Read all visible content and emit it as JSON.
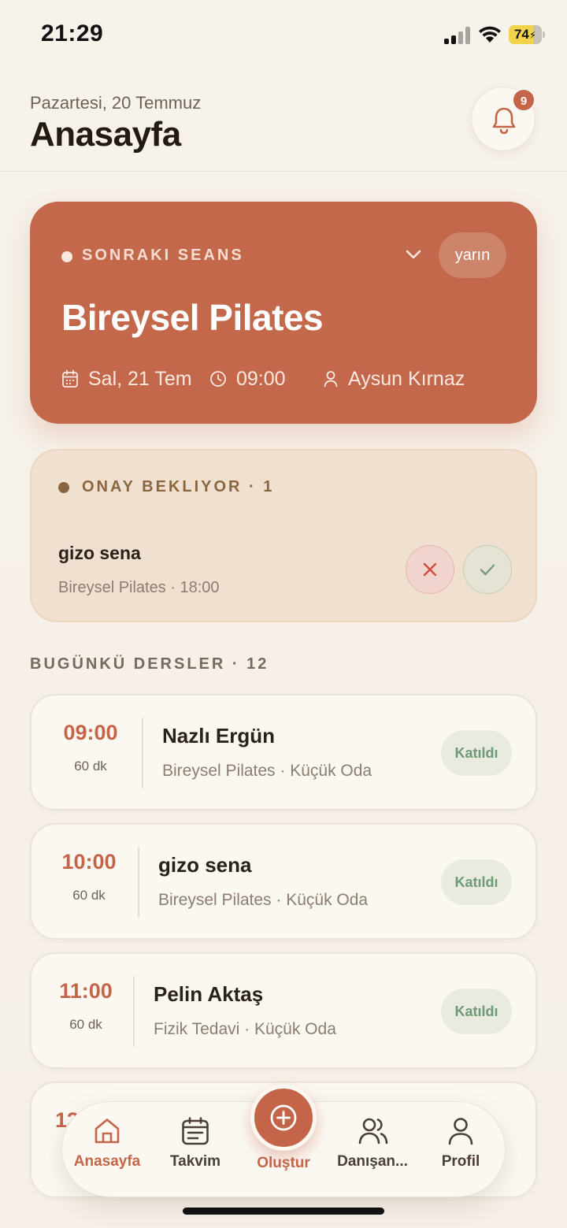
{
  "status_bar": {
    "time": "21:29",
    "battery": "74",
    "battery_level": 0.74
  },
  "header": {
    "date": "Pazartesi, 20 Temmuz",
    "title": "Anasayfa",
    "notification_count": "9"
  },
  "next_session": {
    "label": "SONRAKI SEANS",
    "when_badge": "yarın",
    "title": "Bireysel Pilates",
    "date": "Sal, 21 Tem",
    "time": "09:00",
    "instructor": "Aysun Kırnaz"
  },
  "pending": {
    "label": "ONAY BEKLIYOR · 1",
    "name": "gizo sena",
    "detail": "Bireysel Pilates · 18:00"
  },
  "today": {
    "title": "BUGÜNKÜ DERSLER · 12",
    "lessons": [
      {
        "time": "09:00",
        "duration": "60 dk",
        "name": "Nazlı Ergün",
        "detail": "Bireysel Pilates · Küçük Oda",
        "status": "Katıldı"
      },
      {
        "time": "10:00",
        "duration": "60 dk",
        "name": "gizo sena",
        "detail": "Bireysel Pilates · Küçük Oda",
        "status": "Katıldı"
      },
      {
        "time": "11:00",
        "duration": "60 dk",
        "name": "Pelin Aktaş",
        "detail": "Fizik Tedavi · Küçük Oda",
        "status": "Katıldı"
      },
      {
        "time": "12",
        "duration": "",
        "name": "",
        "detail": "",
        "status": ""
      }
    ]
  },
  "nav": {
    "home": "Anasayfa",
    "calendar": "Takvim",
    "create": "Oluştur",
    "clients": "Danışan...",
    "profile": "Profil"
  },
  "colors": {
    "accent": "#c4654a",
    "pending": "#8a6640",
    "attended": "#6f9a79",
    "background": "#f6f0e9"
  }
}
